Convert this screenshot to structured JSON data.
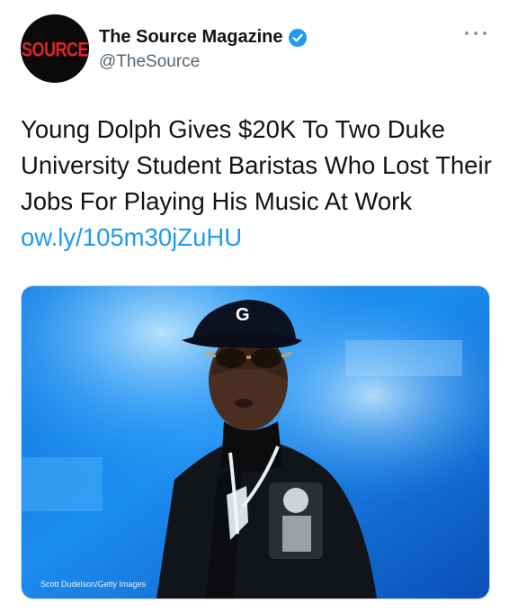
{
  "author": {
    "avatar_text": "SOURCE",
    "display_name": "The Source Magazine",
    "handle": "@TheSource",
    "verified": true
  },
  "tweet": {
    "text": "Young Dolph Gives $20K To Two Duke University Student Baristas Who Lost Their Jobs For Playing His Music At Work",
    "link_text": "ow.ly/105m30jZuHU"
  },
  "media": {
    "cap_logo": "G",
    "credit": "Scott Dudelson/Getty Images"
  },
  "icons": {
    "more": "more-horizontal-icon",
    "verified": "verified-badge-icon"
  },
  "colors": {
    "link": "#1d9bf0",
    "verified": "#1d9bf0",
    "handle": "#536471",
    "avatar_logo": "#e0242b"
  }
}
